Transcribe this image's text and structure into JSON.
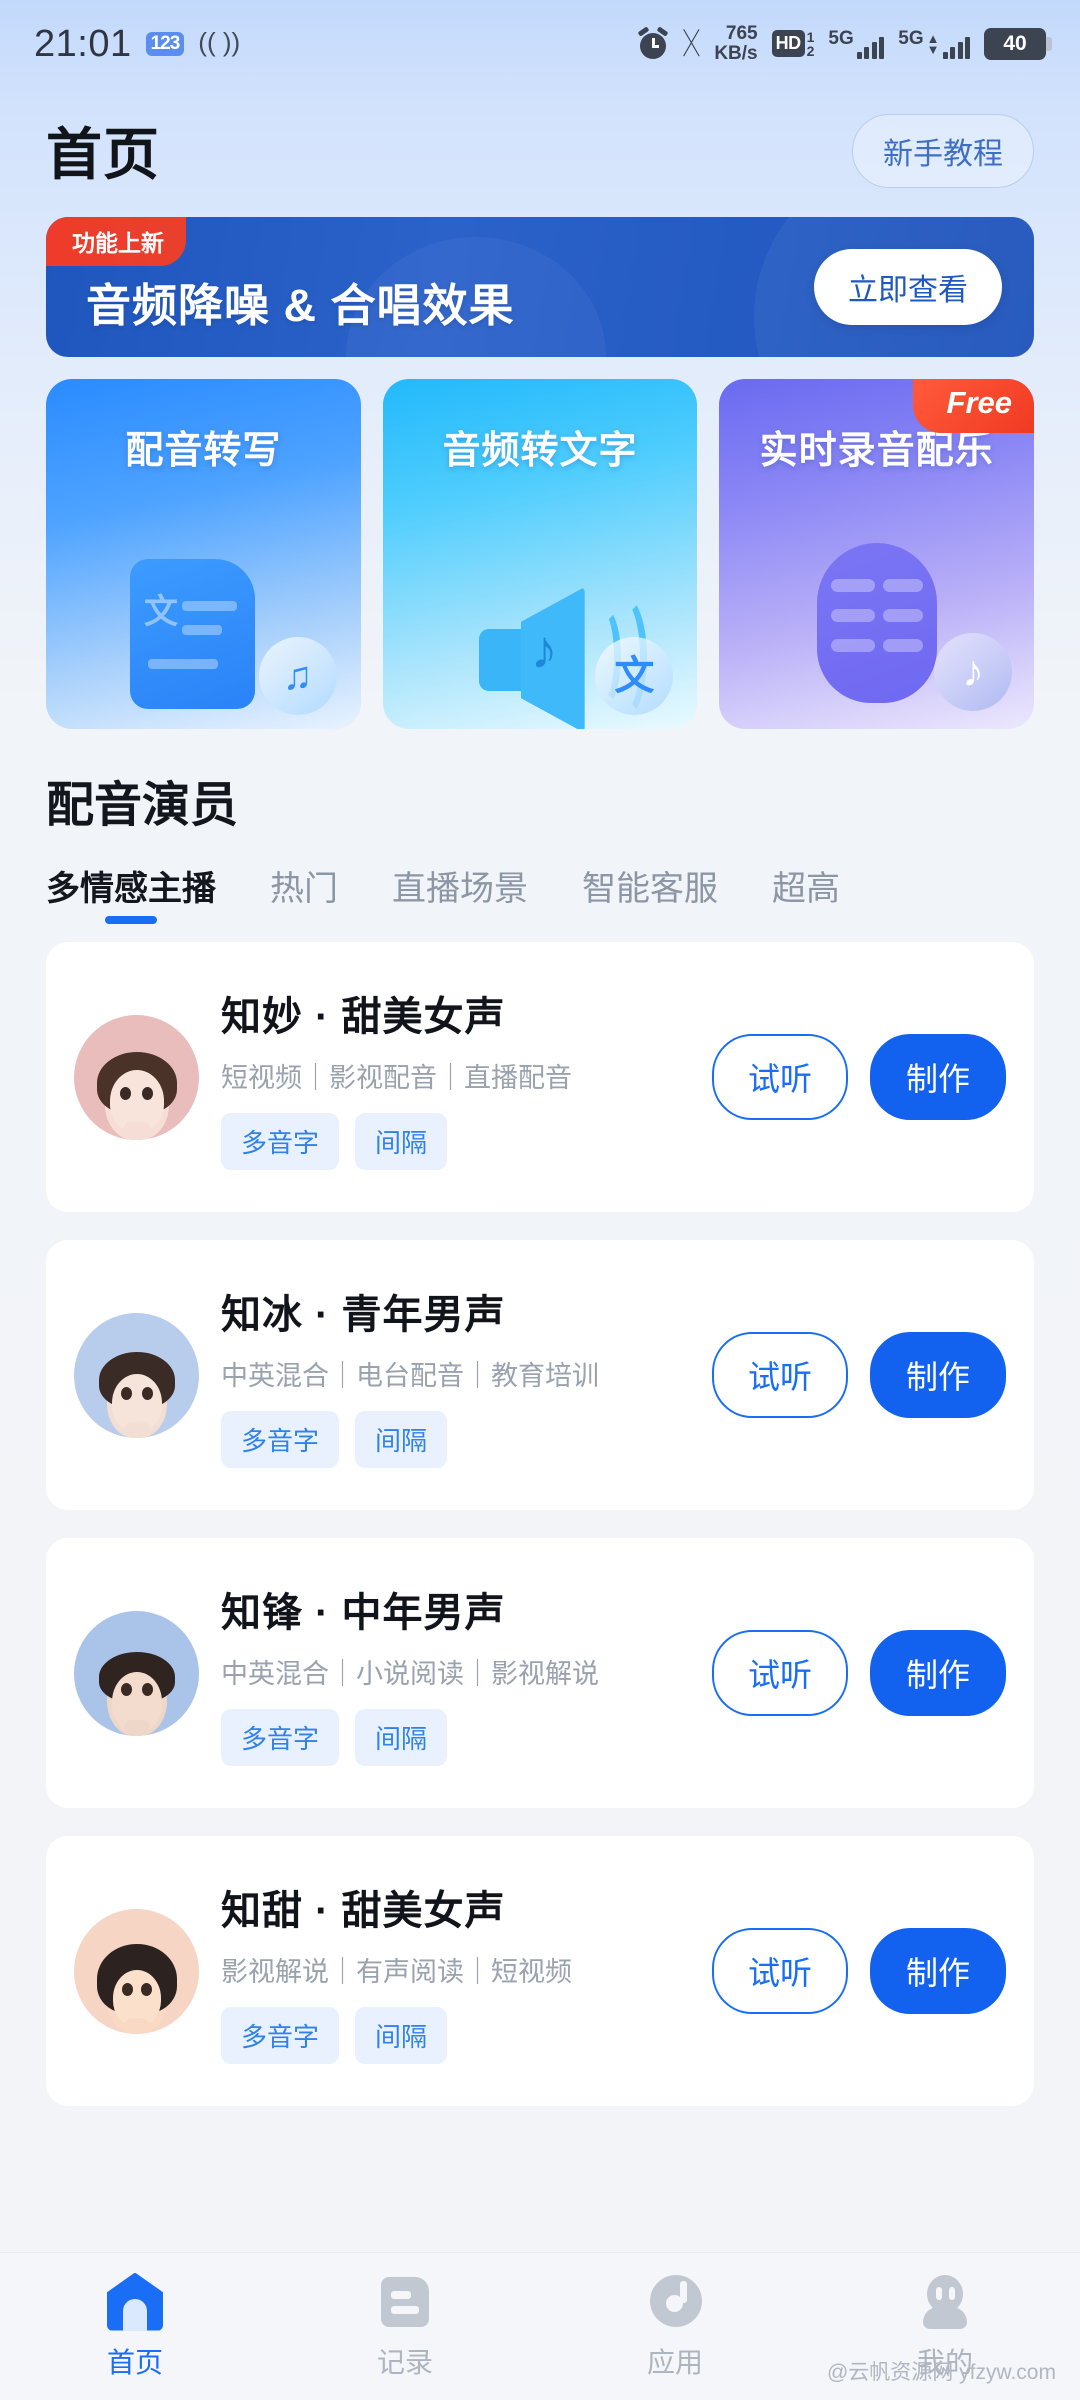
{
  "status_bar": {
    "time": "21:01",
    "chip_label": "123",
    "cast_icon": "cast-icon",
    "alarm_icon": "alarm-clock-icon",
    "bluetooth_icon": "bluetooth-icon",
    "network_speed_value": "765",
    "network_speed_unit": "KB/s",
    "hd_label": "HD",
    "hd_sim_top": "1",
    "hd_sim_bottom": "2",
    "sim1_label": "5G",
    "sim2_label": "5G",
    "battery_level": "40"
  },
  "header": {
    "title": "首页",
    "tutorial_button": "新手教程"
  },
  "banner": {
    "badge": "功能上新",
    "title": "音频降噪 & 合唱效果",
    "cta": "立即查看",
    "bg_color": "#1f56bd",
    "badge_color": "#ef3b2b"
  },
  "feature_cards": [
    {
      "title": "配音转写",
      "icon": "document-audio-icon",
      "badge": "",
      "accent": "#2a8bff"
    },
    {
      "title": "音频转文字",
      "icon": "speaker-text-icon",
      "badge": "",
      "accent": "#22b9fb"
    },
    {
      "title": "实时录音配乐",
      "icon": "microphone-music-icon",
      "badge": "Free",
      "accent": "#6a6af0"
    }
  ],
  "section": {
    "title": "配音演员",
    "tabs": [
      {
        "label": "多情感主播",
        "active": true
      },
      {
        "label": "热门",
        "active": false
      },
      {
        "label": "直播场景",
        "active": false
      },
      {
        "label": "智能客服",
        "active": false
      },
      {
        "label": "超高",
        "active": false
      }
    ]
  },
  "actors": [
    {
      "name": "知妙 · 甜美女声",
      "tags": "短视频｜影视配音｜直播配音",
      "chips": [
        "多音字",
        "间隔"
      ],
      "try_label": "试听",
      "make_label": "制作",
      "avatar": "female-sweet-avatar"
    },
    {
      "name": "知冰 · 青年男声",
      "tags": "中英混合｜电台配音｜教育培训",
      "chips": [
        "多音字",
        "间隔"
      ],
      "try_label": "试听",
      "make_label": "制作",
      "avatar": "young-male-avatar"
    },
    {
      "name": "知锋 · 中年男声",
      "tags": "中英混合｜小说阅读｜影视解说",
      "chips": [
        "多音字",
        "间隔"
      ],
      "try_label": "试听",
      "make_label": "制作",
      "avatar": "middle-aged-male-avatar"
    },
    {
      "name": "知甜 · 甜美女声",
      "tags": "影视解说｜有声阅读｜短视频",
      "chips": [
        "多音字",
        "间隔"
      ],
      "try_label": "试听",
      "make_label": "制作",
      "avatar": "female-sweet2-avatar"
    }
  ],
  "bottom_nav": {
    "items": [
      {
        "label": "首页",
        "icon": "home-icon",
        "active": true
      },
      {
        "label": "记录",
        "icon": "records-icon",
        "active": false
      },
      {
        "label": "应用",
        "icon": "apps-icon",
        "active": false
      },
      {
        "label": "我的",
        "icon": "profile-icon",
        "active": false
      }
    ]
  },
  "watermark": "@云帆资源网 yfzyw.com",
  "theme": {
    "primary": "#1a6ef5",
    "primary_dark": "#1362ef",
    "accent_red": "#ef3b2b",
    "muted_text": "#9aa2ae"
  }
}
